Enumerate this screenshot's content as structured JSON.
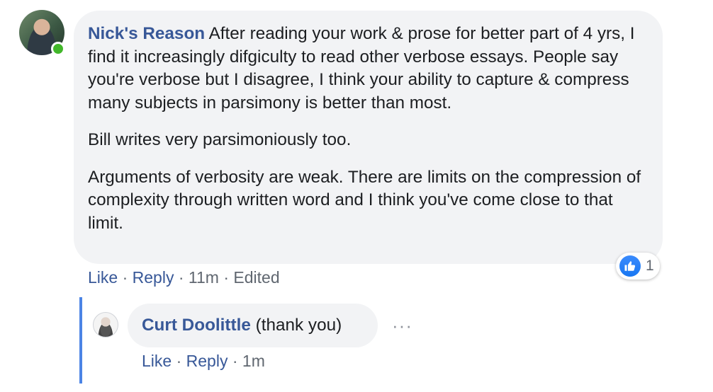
{
  "comment": {
    "author": "Nick's Reason",
    "paragraphs": [
      "After reading your work & prose for better part of 4 yrs, I find it increasingly difgiculty to read other verbose essays. People say you're verbose but I disagree, I think your ability to capture & compress many subjects in parsimony is better than most.",
      "Bill writes very parsimoniously too.",
      "Arguments of verbosity are weak. There are limits on the compression of complexity through written word and I think you've come close to that limit."
    ],
    "actions": {
      "like": "Like",
      "reply": "Reply",
      "time": "11m",
      "edited": "Edited",
      "separator": "·"
    },
    "reaction": {
      "icon": "thumbs-up-icon",
      "count": "1",
      "color": "#1877f2"
    }
  },
  "reply": {
    "author": "Curt Doolittle",
    "text": "(thank you)",
    "actions": {
      "like": "Like",
      "reply": "Reply",
      "time": "1m",
      "separator": "·"
    },
    "more": "···"
  },
  "colors": {
    "link": "#385898",
    "bubble": "#f2f3f5",
    "thread_line": "#4b84e5",
    "online": "#42b72a"
  }
}
